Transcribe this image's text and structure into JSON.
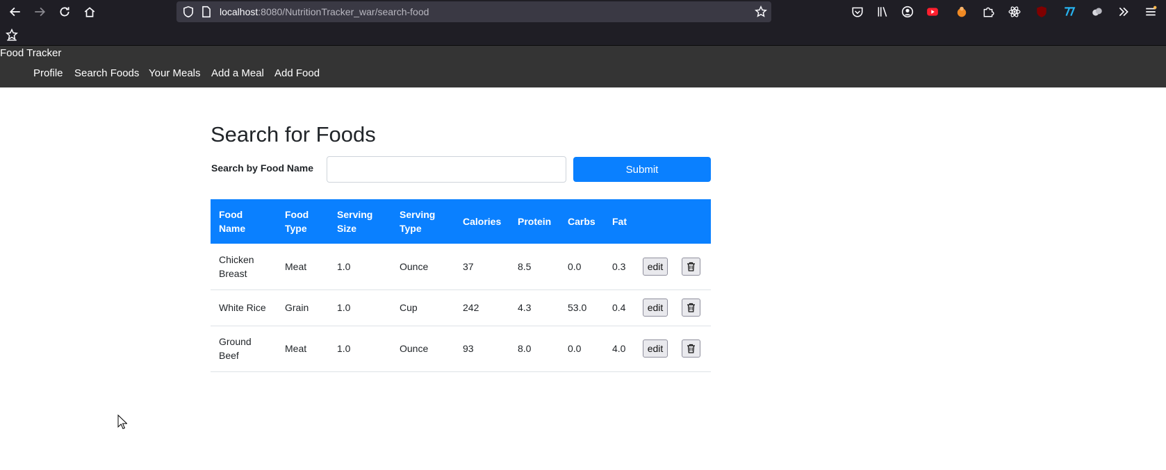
{
  "browser": {
    "url_host": "localhost",
    "url_rest": ":8080/NutritionTracker_war/search-food"
  },
  "navbar": {
    "brand": "Food Tracker",
    "links": [
      "Profile",
      "Search Foods",
      "Your Meals",
      "Add a Meal",
      "Add Food"
    ]
  },
  "page": {
    "title": "Search for Foods",
    "search_label": "Search by Food Name",
    "search_value": "",
    "submit_label": "Submit"
  },
  "table": {
    "headers": [
      [
        "Food",
        "Name"
      ],
      [
        "Food",
        "Type"
      ],
      [
        "Serving",
        "Size"
      ],
      [
        "Serving",
        "Type"
      ],
      [
        "Calories"
      ],
      [
        "Protein"
      ],
      [
        "Carbs"
      ],
      [
        "Fat"
      ]
    ],
    "rows": [
      {
        "name": [
          "Chicken",
          "Breast"
        ],
        "type": "Meat",
        "size": "1.0",
        "serving_type": "Ounce",
        "calories": "37",
        "protein": "8.5",
        "carbs": "0.0",
        "fat": "0.3",
        "edit_label": "edit"
      },
      {
        "name": [
          "White Rice"
        ],
        "type": "Grain",
        "size": "1.0",
        "serving_type": "Cup",
        "calories": "242",
        "protein": "4.3",
        "carbs": "53.0",
        "fat": "0.4",
        "edit_label": "edit"
      },
      {
        "name": [
          "Ground",
          "Beef"
        ],
        "type": "Meat",
        "size": "1.0",
        "serving_type": "Ounce",
        "calories": "93",
        "protein": "8.0",
        "carbs": "0.0",
        "fat": "4.0",
        "edit_label": "edit"
      }
    ]
  },
  "icons": {
    "back": "arrow-left-icon",
    "forward": "arrow-right-icon",
    "reload": "reload-icon",
    "home": "home-icon",
    "shield": "shield-icon",
    "page": "page-icon",
    "star": "bookmark-star-icon",
    "delete": "trash-icon"
  },
  "colors": {
    "accent": "#0a80ff",
    "navbar_bg": "#343434",
    "chrome_bg": "#1f1e25"
  }
}
